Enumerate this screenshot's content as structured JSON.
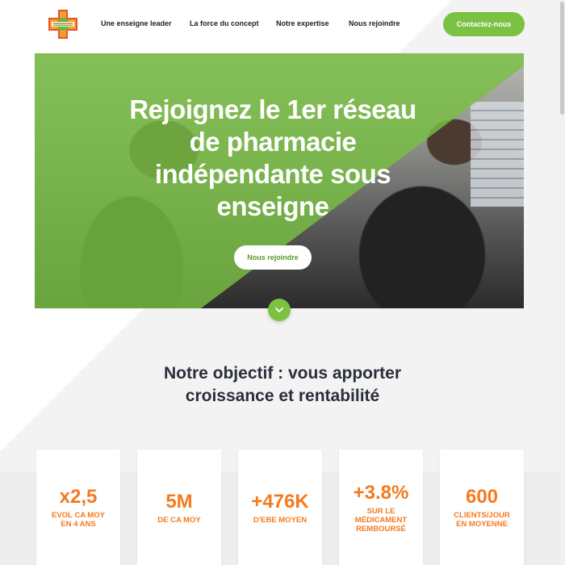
{
  "header": {
    "logo_name": "pharmacie-logo",
    "nav": [
      {
        "label": "Une enseigne leader"
      },
      {
        "label": "La force du concept"
      },
      {
        "label": "Notre expertise"
      },
      {
        "label": "Nous rejoindre"
      }
    ],
    "cta_label": "Contactez-nous"
  },
  "hero": {
    "title": "Rejoignez le 1er réseau de pharmacie indépendante sous enseigne",
    "button_label": "Nous rejoindre",
    "scroll_icon": "chevron-down-icon"
  },
  "section": {
    "title_line1": "Notre objectif : vous apporter",
    "title_line2": "croissance et rentabilité"
  },
  "stats": [
    {
      "value": "x2,5",
      "label": "EVOL CA MOY EN 4 ANS"
    },
    {
      "value": "5M",
      "label": "DE CA MOY"
    },
    {
      "value": "+476K",
      "label": "D'EBE MOYEN"
    },
    {
      "value": "+3.8%",
      "label": "SUR LE MÉDICAMENT REMBOURSÉ"
    },
    {
      "value": "600",
      "label": "CLIENTS/JOUR EN MOYENNE"
    }
  ],
  "colors": {
    "accent_green": "#7bc142",
    "stat_orange": "#f47a1f",
    "title_dark": "#2b2f3a"
  }
}
